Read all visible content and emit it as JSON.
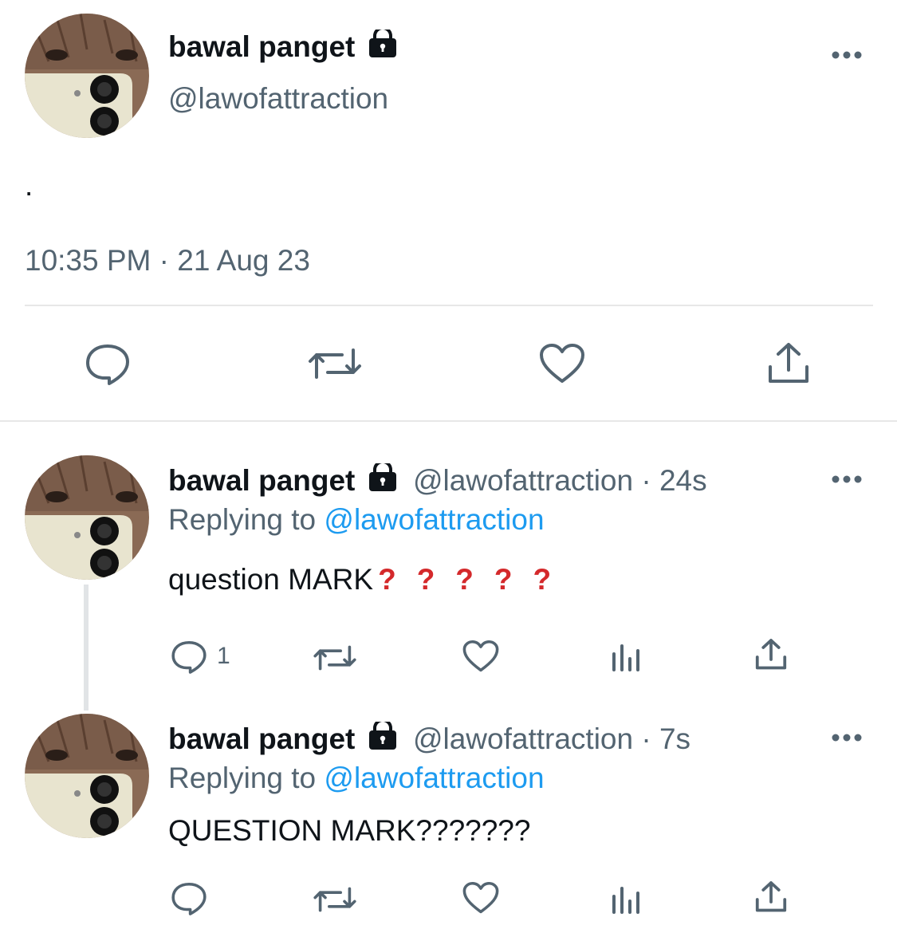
{
  "main_tweet": {
    "display_name": "bawal panget",
    "handle": "@lawofattraction",
    "body": ".",
    "timestamp": "10:35 PM · 21 Aug 23",
    "actions": [
      "reply-icon",
      "retweet-icon",
      "like-icon",
      "share-icon"
    ]
  },
  "replies": [
    {
      "display_name": "bawal panget",
      "handle": "@lawofattraction",
      "time_ago": "· 24s",
      "replying_to_label": "Replying to",
      "replying_to_handle": "@lawofattraction",
      "text": "question MARK",
      "emoji_marks": [
        "?",
        "?",
        "?",
        "?",
        "?"
      ],
      "reply_count": "1",
      "actions": [
        "reply-icon",
        "retweet-icon",
        "like-icon",
        "views-icon",
        "share-icon"
      ]
    },
    {
      "display_name": "bawal panget",
      "handle": "@lawofattraction",
      "time_ago": "· 7s",
      "replying_to_label": "Replying to",
      "replying_to_handle": "@lawofattraction",
      "text": "QUESTION MARK???????",
      "actions": [
        "reply-icon",
        "retweet-icon",
        "like-icon",
        "views-icon",
        "share-icon"
      ]
    }
  ],
  "colors": {
    "text": "#0f1419",
    "secondary": "#536471",
    "link": "#1d9bf0",
    "emoji_question": "#d4292b"
  }
}
